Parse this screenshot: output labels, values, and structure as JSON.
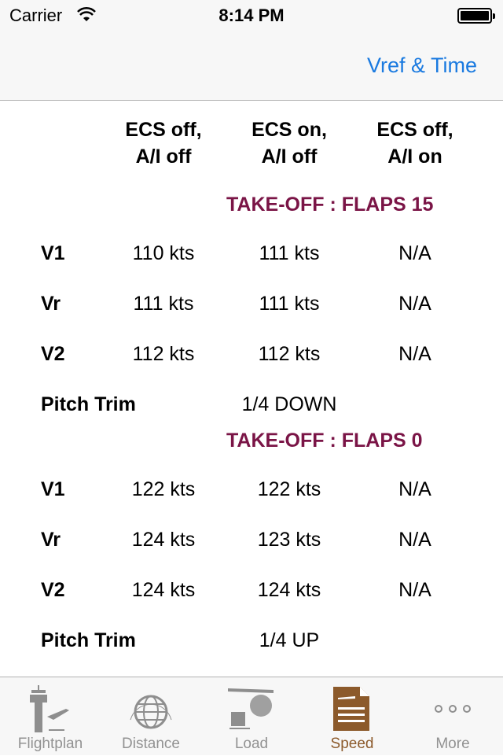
{
  "status": {
    "carrier": "Carrier",
    "time": "8:14 PM"
  },
  "nav": {
    "right_button": "Vref & Time"
  },
  "columns": [
    [
      "ECS off,",
      "A/I off"
    ],
    [
      "ECS on,",
      "A/I off"
    ],
    [
      "ECS off,",
      "A/I on"
    ]
  ],
  "sections": [
    {
      "title": "TAKE-OFF : FLAPS 15",
      "rows": [
        {
          "label": "V1",
          "values": [
            "110 kts",
            "111 kts",
            "N/A"
          ]
        },
        {
          "label": "Vr",
          "values": [
            "111 kts",
            "111 kts",
            "N/A"
          ]
        },
        {
          "label": "V2",
          "values": [
            "112 kts",
            "112 kts",
            "N/A"
          ]
        }
      ],
      "trim": {
        "label": "Pitch Trim",
        "value": "1/4 DOWN"
      }
    },
    {
      "title": "TAKE-OFF : FLAPS 0",
      "rows": [
        {
          "label": "V1",
          "values": [
            "122 kts",
            "122 kts",
            "N/A"
          ]
        },
        {
          "label": "Vr",
          "values": [
            "124 kts",
            "123 kts",
            "N/A"
          ]
        },
        {
          "label": "V2",
          "values": [
            "124 kts",
            "124 kts",
            "N/A"
          ]
        }
      ],
      "trim": {
        "label": "Pitch Trim",
        "value": "1/4 UP"
      }
    }
  ],
  "tabs": [
    {
      "label": "Flightplan",
      "icon": "control-tower-icon"
    },
    {
      "label": "Distance",
      "icon": "globe-icon"
    },
    {
      "label": "Load",
      "icon": "luggage-engine-icon"
    },
    {
      "label": "Speed",
      "icon": "document-plane-icon",
      "active": true
    },
    {
      "label": "More",
      "icon": "more-dots-icon"
    }
  ],
  "colors": {
    "accent": "#1a7ae0",
    "section": "#7a1446",
    "active_tab": "#8c5a2b"
  }
}
